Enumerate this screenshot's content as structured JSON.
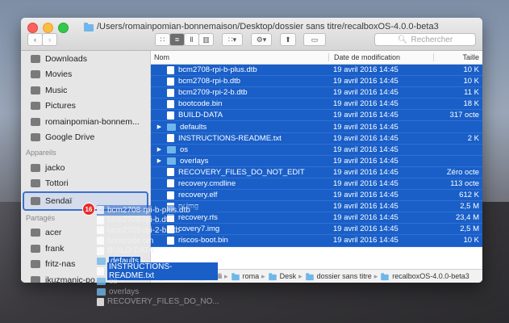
{
  "window": {
    "title": "/Users/romainpomian-bonnemaison/Desktop/dossier sans titre/recalboxOS-4.0.0-beta3",
    "search_placeholder": "Rechercher"
  },
  "sidebar": {
    "favorites": [
      {
        "label": "Downloads",
        "icon": "downloads-icon"
      },
      {
        "label": "Movies",
        "icon": "movies-icon"
      },
      {
        "label": "Music",
        "icon": "music-icon"
      },
      {
        "label": "Pictures",
        "icon": "pictures-icon"
      },
      {
        "label": "romainpomian-bonnem...",
        "icon": "home-icon"
      },
      {
        "label": "Google Drive",
        "icon": "folder-icon"
      }
    ],
    "devices_header": "Appareils",
    "devices": [
      {
        "label": "jacko",
        "icon": "computer-icon"
      },
      {
        "label": "Tottori",
        "icon": "disk-icon"
      },
      {
        "label": "Sendaï",
        "icon": "disk-icon"
      }
    ],
    "shared_header": "Partagés",
    "shared": [
      {
        "label": "acer",
        "icon": "monitor-icon"
      },
      {
        "label": "frank",
        "icon": "monitor-icon"
      },
      {
        "label": "fritz-nas",
        "icon": "monitor-icon"
      },
      {
        "label": "ikuzmanic-po",
        "icon": "monitor-icon"
      }
    ]
  },
  "columns": {
    "name": "Nom",
    "date": "Date de modification",
    "size": "Taille"
  },
  "files": [
    {
      "name": "bcm2708-rpi-b-plus.dtb",
      "date": "19 avril 2016 14:45",
      "size": "10 K",
      "type": "file"
    },
    {
      "name": "bcm2708-rpi-b.dtb",
      "date": "19 avril 2016 14:45",
      "size": "10 K",
      "type": "file"
    },
    {
      "name": "bcm2709-rpi-2-b.dtb",
      "date": "19 avril 2016 14:45",
      "size": "11 K",
      "type": "file"
    },
    {
      "name": "bootcode.bin",
      "date": "19 avril 2016 14:45",
      "size": "18 K",
      "type": "file"
    },
    {
      "name": "BUILD-DATA",
      "date": "19 avril 2016 14:45",
      "size": "317 octe",
      "type": "file"
    },
    {
      "name": "defaults",
      "date": "19 avril 2016 14:45",
      "size": "",
      "type": "folder"
    },
    {
      "name": "INSTRUCTIONS-README.txt",
      "date": "19 avril 2016 14:45",
      "size": "2 K",
      "type": "file"
    },
    {
      "name": "os",
      "date": "19 avril 2016 14:45",
      "size": "",
      "type": "folder"
    },
    {
      "name": "overlays",
      "date": "19 avril 2016 14:45",
      "size": "",
      "type": "folder"
    },
    {
      "name": "RECOVERY_FILES_DO_NOT_EDIT",
      "date": "19 avril 2016 14:45",
      "size": "Zéro octe",
      "type": "file"
    },
    {
      "name": "recovery.cmdline",
      "date": "19 avril 2016 14:45",
      "size": "113 octe",
      "type": "file"
    },
    {
      "name": "recovery.elf",
      "date": "19 avril 2016 14:45",
      "size": "612 K",
      "type": "file"
    },
    {
      "name": "ry.img",
      "date": "19 avril 2016 14:45",
      "size": "2,5 M",
      "type": "file"
    },
    {
      "name": "recovery.rfs",
      "date": "19 avril 2016 14:45",
      "size": "23,4 M",
      "type": "file"
    },
    {
      "name": "covery7.img",
      "date": "19 avril 2016 14:45",
      "size": "2,5 M",
      "type": "file"
    },
    {
      "name": "riscos-boot.bin",
      "date": "19 avril 2016 14:45",
      "size": "10 K",
      "type": "file"
    }
  ],
  "pathbar": [
    "Tottori",
    "Utili",
    "roma",
    "Desk",
    "dossier sans titre",
    "recalboxOS-4.0.0-beta3"
  ],
  "drag": {
    "count": "16",
    "items": [
      "bcm2708-rpi-b-plus.dtb",
      "bcm2708-rpi-b.dtb",
      "bcm2709-rpi-2-b.dtb",
      "bootcode.bin",
      "BUILD-DATA",
      "defaults",
      "INSTRUCTIONS-README.txt",
      "os",
      "overlays",
      "RECOVERY_FILES_DO_NO..."
    ]
  }
}
